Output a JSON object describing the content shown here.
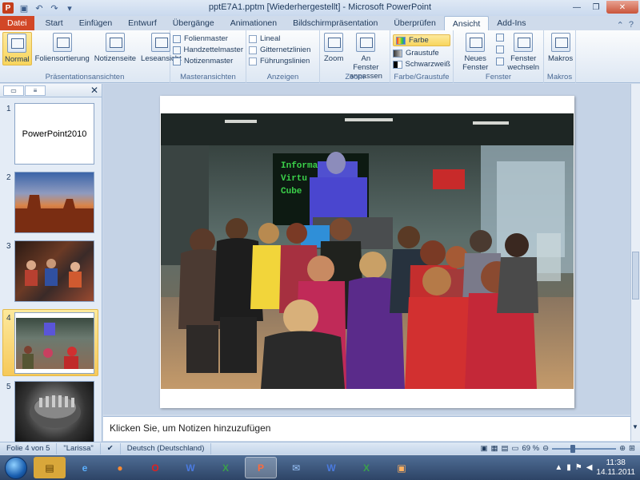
{
  "title_bar": {
    "app_icon": "P",
    "title": "pptE7A1.pptm [Wiederhergestellt]  -  Microsoft PowerPoint"
  },
  "tabs": [
    "Datei",
    "Start",
    "Einfügen",
    "Entwurf",
    "Übergänge",
    "Animationen",
    "Bildschirmpräsentation",
    "Überprüfen",
    "Ansicht",
    "Add-Ins"
  ],
  "active_tab": "Ansicht",
  "ribbon": {
    "praesentationsansichten": {
      "label": "Präsentationsansichten",
      "buttons": [
        "Normal",
        "Foliensortierung",
        "Notizenseite",
        "Leseansicht"
      ],
      "selected": "Normal"
    },
    "masteransichten": {
      "label": "Masteransichten",
      "items": [
        "Folienmaster",
        "Handzettelmaster",
        "Notizenmaster"
      ]
    },
    "anzeigen": {
      "label": "Anzeigen",
      "items": [
        "Lineal",
        "Gitternetzlinien",
        "Führungslinien"
      ]
    },
    "zoom": {
      "label": "Zoom",
      "buttons": [
        "Zoom",
        "An Fenster anpassen"
      ]
    },
    "farbe": {
      "label": "Farbe/Graustufe",
      "items": [
        "Farbe",
        "Graustufe",
        "Schwarzweiß"
      ],
      "selected": "Farbe"
    },
    "fenster": {
      "label": "Fenster",
      "buttons": [
        "Neues Fenster",
        "Fenster wechseln"
      ]
    },
    "makros": {
      "label": "Makros",
      "buttons": [
        "Makros"
      ]
    }
  },
  "slides": [
    {
      "num": "1",
      "title": "PowerPoint2010"
    },
    {
      "num": "2"
    },
    {
      "num": "3"
    },
    {
      "num": "4",
      "selected": true
    },
    {
      "num": "5"
    }
  ],
  "notes_placeholder": "Klicken Sie, um Notizen hinzuzufügen",
  "status_bar": {
    "slide": "Folie 4 von 5",
    "theme": "\"Larissa\"",
    "language": "Deutsch (Deutschland)",
    "zoom": "69 %",
    "zoom_level": 0.69
  },
  "clock": {
    "time": "11:38",
    "date": "14.11.2011"
  },
  "colors": {
    "accent": "#d24726",
    "selection": "#f8d55d",
    "ribbon": "#dde7f3"
  }
}
